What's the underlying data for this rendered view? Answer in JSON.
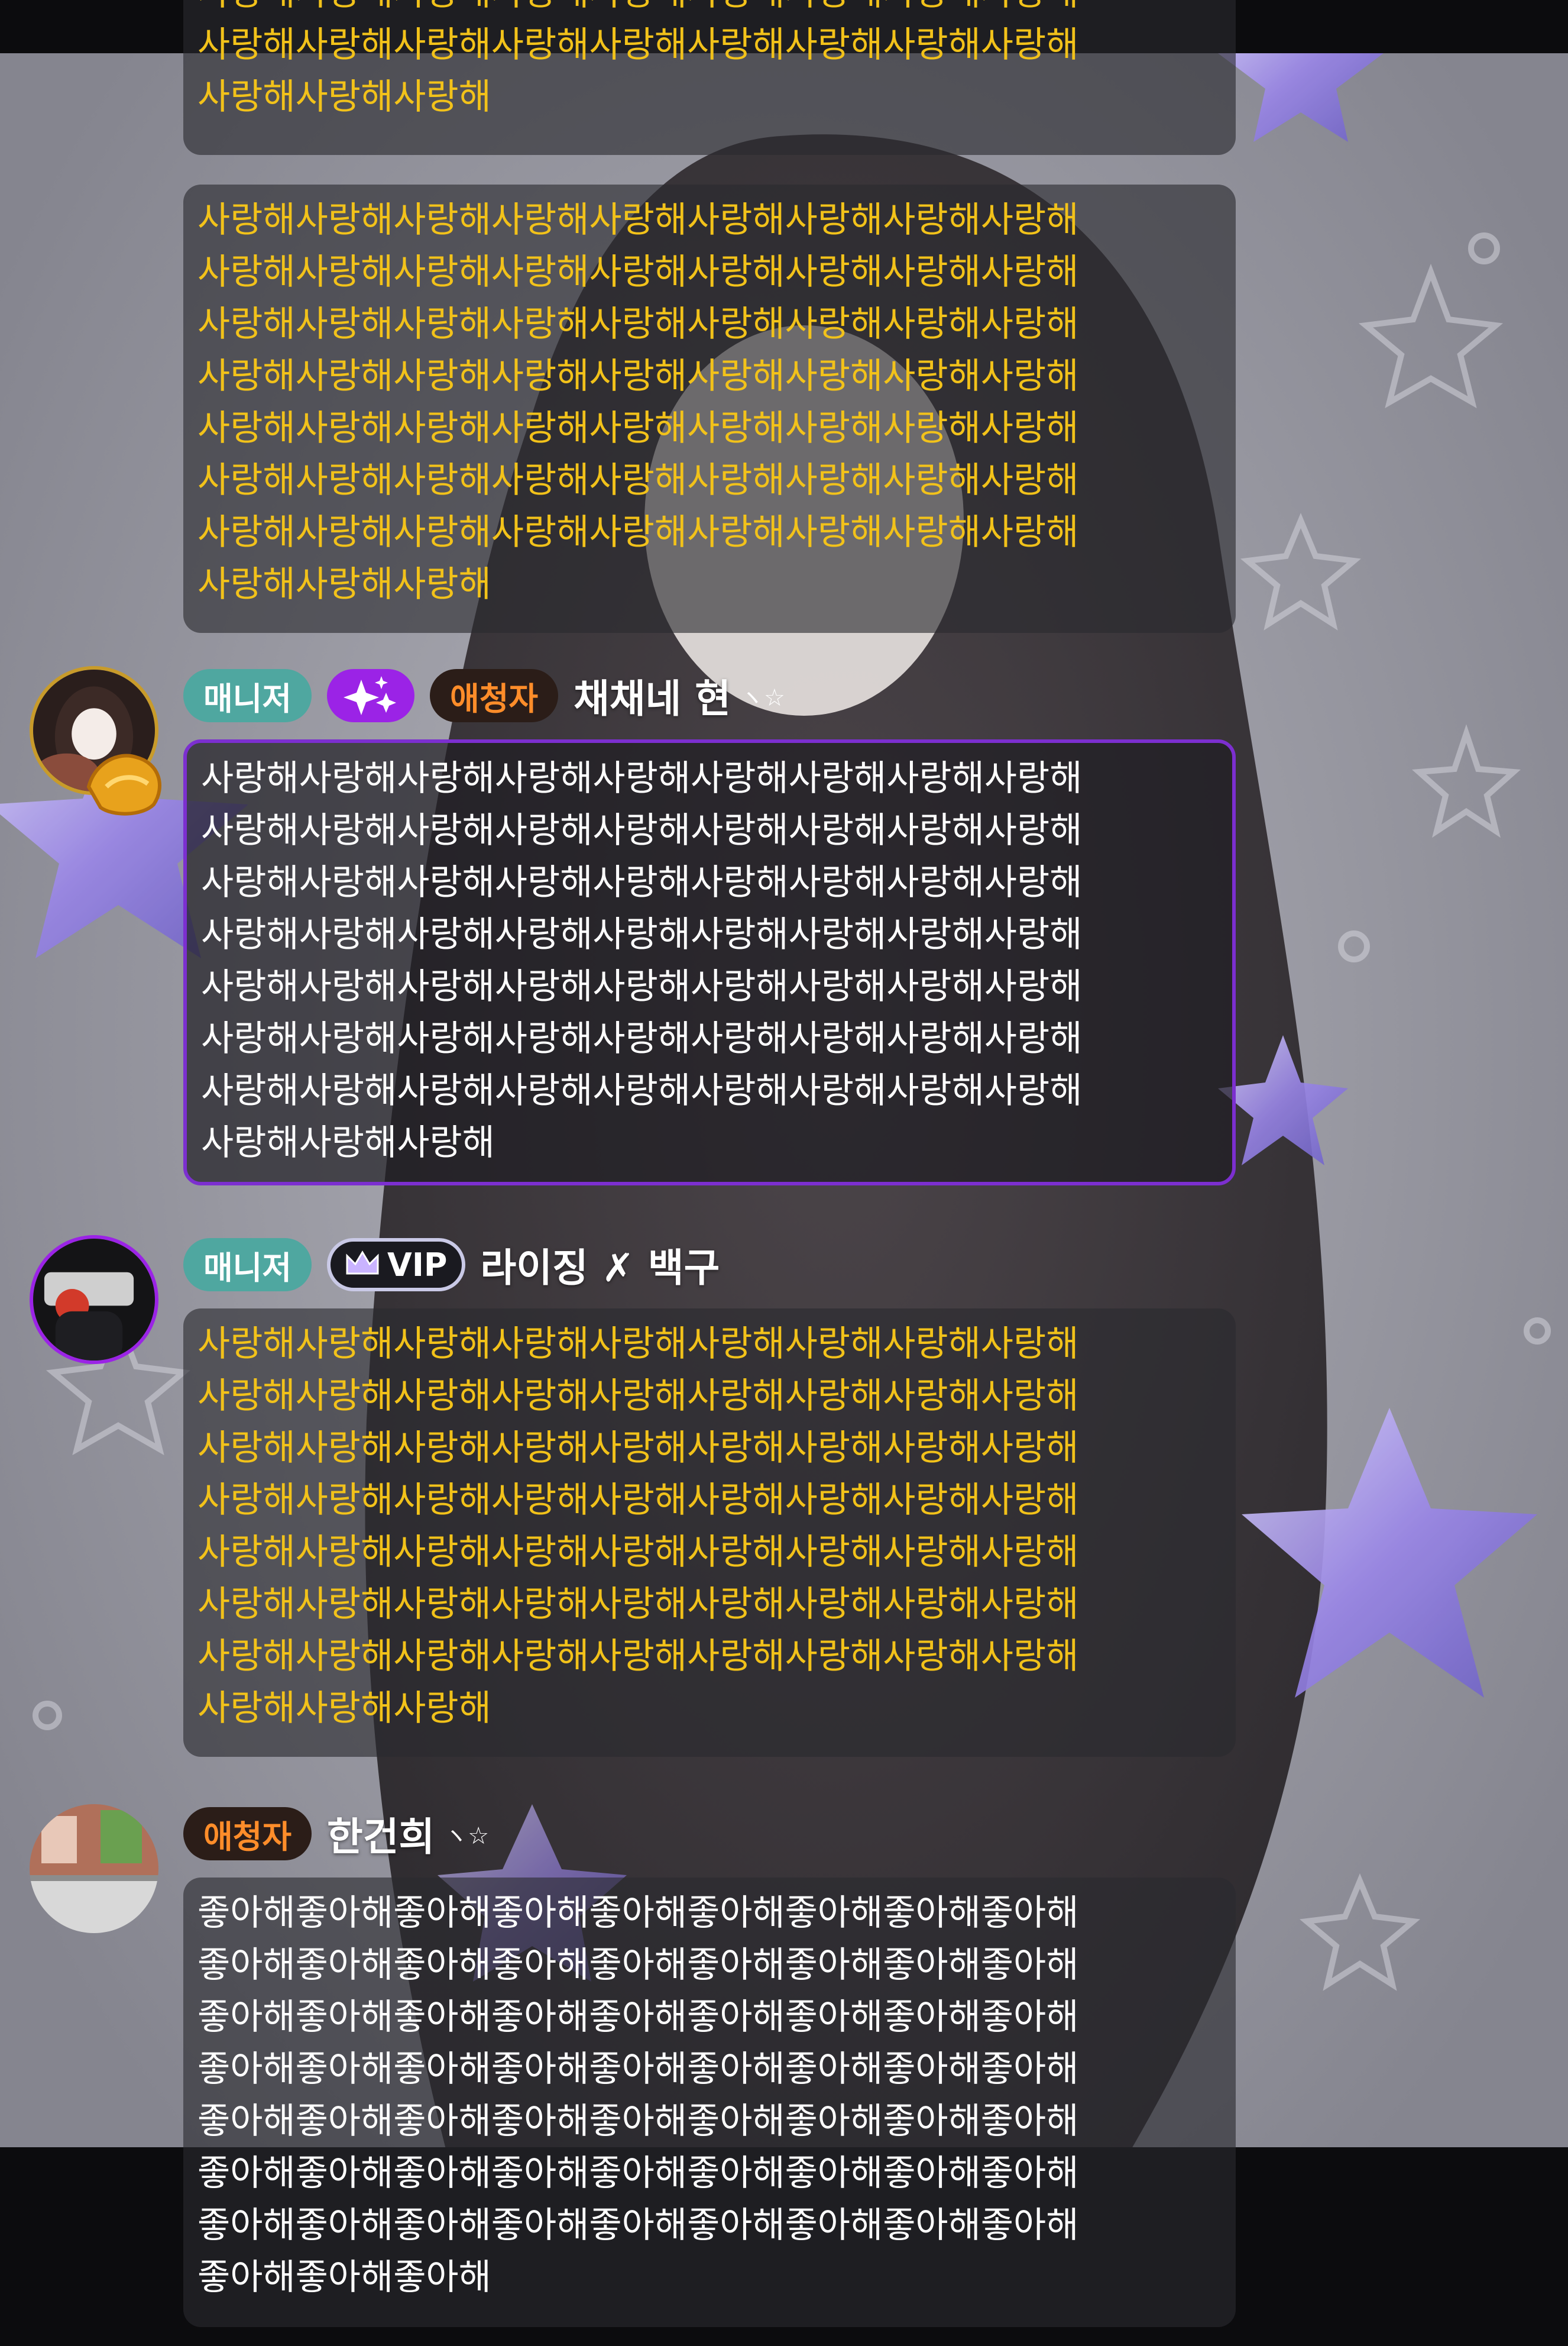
{
  "colors": {
    "manager_badge": "#4fa7a0",
    "fan_badge_text": "#ff8d2a",
    "sparkle_badge": "#9b23e6",
    "highlight_text": "#f2c21a",
    "bubble_border_purple": "#7c2fd0"
  },
  "messages": [
    {
      "text_style": "yellow",
      "text": "사랑해사랑해사랑해사랑해사랑해사랑해사랑해사랑해사랑해\n사랑해사랑해사랑해사랑해사랑해사랑해사랑해사랑해사랑해\n사랑해사랑해사랑해"
    },
    {
      "text_style": "yellow",
      "text": "사랑해사랑해사랑해사랑해사랑해사랑해사랑해사랑해사랑해\n사랑해사랑해사랑해사랑해사랑해사랑해사랑해사랑해사랑해\n사랑해사랑해사랑해사랑해사랑해사랑해사랑해사랑해사랑해\n사랑해사랑해사랑해사랑해사랑해사랑해사랑해사랑해사랑해\n사랑해사랑해사랑해사랑해사랑해사랑해사랑해사랑해사랑해\n사랑해사랑해사랑해사랑해사랑해사랑해사랑해사랑해사랑해\n사랑해사랑해사랑해사랑해사랑해사랑해사랑해사랑해사랑해\n사랑해사랑해사랑해"
    },
    {
      "user": {
        "badges": [
          "매니저",
          "sparkle-icon",
          "애청자"
        ],
        "nickname": "채채네 현",
        "nickname_deco": "ヽ☆"
      },
      "text_style": "white",
      "text": "사랑해사랑해사랑해사랑해사랑해사랑해사랑해사랑해사랑해\n사랑해사랑해사랑해사랑해사랑해사랑해사랑해사랑해사랑해\n사랑해사랑해사랑해사랑해사랑해사랑해사랑해사랑해사랑해\n사랑해사랑해사랑해사랑해사랑해사랑해사랑해사랑해사랑해\n사랑해사랑해사랑해사랑해사랑해사랑해사랑해사랑해사랑해\n사랑해사랑해사랑해사랑해사랑해사랑해사랑해사랑해사랑해\n사랑해사랑해사랑해사랑해사랑해사랑해사랑해사랑해사랑해\n사랑해사랑해사랑해"
    },
    {
      "user": {
        "badges": [
          "매니저",
          "VIP"
        ],
        "nickname": "라이징 ✗ 백구"
      },
      "text_style": "yellow",
      "text": "사랑해사랑해사랑해사랑해사랑해사랑해사랑해사랑해사랑해\n사랑해사랑해사랑해사랑해사랑해사랑해사랑해사랑해사랑해\n사랑해사랑해사랑해사랑해사랑해사랑해사랑해사랑해사랑해\n사랑해사랑해사랑해사랑해사랑해사랑해사랑해사랑해사랑해\n사랑해사랑해사랑해사랑해사랑해사랑해사랑해사랑해사랑해\n사랑해사랑해사랑해사랑해사랑해사랑해사랑해사랑해사랑해\n사랑해사랑해사랑해사랑해사랑해사랑해사랑해사랑해사랑해\n사랑해사랑해사랑해"
    },
    {
      "user": {
        "badges": [
          "애청자"
        ],
        "nickname": "한건희",
        "nickname_deco": "ヽ☆"
      },
      "text_style": "white",
      "text": "좋아해좋아해좋아해좋아해좋아해좋아해좋아해좋아해좋아해\n좋아해좋아해좋아해좋아해좋아해좋아해좋아해좋아해좋아해\n좋아해좋아해좋아해좋아해좋아해좋아해좋아해좋아해좋아해\n좋아해좋아해좋아해좋아해좋아해좋아해좋아해좋아해좋아해\n좋아해좋아해좋아해좋아해좋아해좋아해좋아해좋아해좋아해\n좋아해좋아해좋아해좋아해좋아해좋아해좋아해좋아해좋아해\n좋아해좋아해좋아해좋아해좋아해좋아해좋아해좋아해좋아해\n좋아해좋아해좋아해"
    }
  ]
}
